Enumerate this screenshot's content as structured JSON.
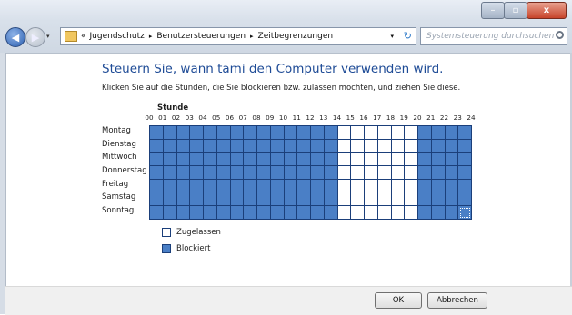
{
  "window": {
    "minimize_label": "–",
    "maximize_label": "▫",
    "close_label": "x"
  },
  "nav": {
    "back_label": "◀",
    "forward_label": "▶",
    "dropdown_label": "▾"
  },
  "address": {
    "prefix": "«",
    "crumbs": [
      "Jugendschutz",
      "Benutzersteuerungen",
      "Zeitbegrenzungen"
    ],
    "separator": "▸",
    "dropdown": "▾",
    "refresh": "↻"
  },
  "search": {
    "placeholder": "Systemsteuerung durchsuchen"
  },
  "heading": "Steuern Sie, wann tami den Computer verwenden wird.",
  "instruction": "Klicken Sie auf die Stunden, die Sie blockieren bzw. zulassen möchten, und ziehen Sie diese.",
  "grid": {
    "hour_header": "Stunde",
    "hours": [
      "00",
      "01",
      "02",
      "03",
      "04",
      "05",
      "06",
      "07",
      "08",
      "09",
      "10",
      "11",
      "12",
      "13",
      "14",
      "15",
      "16",
      "17",
      "18",
      "19",
      "20",
      "21",
      "22",
      "23",
      "24"
    ],
    "days": [
      "Montag",
      "Dienstag",
      "Mittwoch",
      "Donnerstag",
      "Freitag",
      "Samstag",
      "Sonntag"
    ],
    "allowed_hours": [
      14,
      15,
      16,
      17,
      18,
      19
    ],
    "colors": {
      "blocked": "#4a7fc6",
      "allowed": "#ffffff"
    }
  },
  "legend": {
    "allowed": "Zugelassen",
    "blocked": "Blockiert"
  },
  "buttons": {
    "ok": "OK",
    "cancel": "Abbrechen"
  }
}
